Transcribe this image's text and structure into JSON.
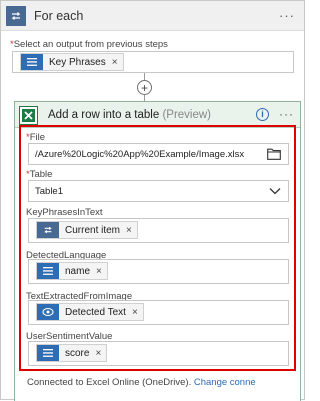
{
  "foreach": {
    "title": "For each",
    "more": "···",
    "select_label": "Select an output from previous steps",
    "required_mark": "*",
    "token": {
      "label": "Key Phrases",
      "close": "×",
      "icon": "list-icon"
    }
  },
  "add_step": {
    "label": "+"
  },
  "action": {
    "title": "Add a row into a table",
    "preview": "(Preview)",
    "info": "i",
    "more": "···",
    "icon": "excel-icon",
    "fields": {
      "file": {
        "label": "File",
        "required": "*",
        "value": "/Azure%20Logic%20App%20Example/Image.xlsx",
        "icon": "folder-icon"
      },
      "table": {
        "label": "Table",
        "required": "*",
        "value": "Table1",
        "icon": "chevron-down-icon"
      },
      "key_phrases": {
        "label": "KeyPhrasesInText",
        "token": {
          "label": "Current item",
          "close": "×",
          "icon": "loop-icon"
        }
      },
      "detected_language": {
        "label": "DetectedLanguage",
        "token": {
          "label": "name",
          "close": "×",
          "icon": "list-icon"
        }
      },
      "text_extracted": {
        "label": "TextExtractedFromImage",
        "token": {
          "label": "Detected Text",
          "close": "×",
          "icon": "eye-icon"
        }
      },
      "user_sentiment": {
        "label": "UserSentimentValue",
        "token": {
          "label": "score",
          "close": "×",
          "icon": "list-icon"
        }
      }
    },
    "connection_text": "Connected to Excel Online (OneDrive).",
    "change_link": "Change conne"
  },
  "colors": {
    "foreach_icon": "#486991",
    "token_blue": "#2e6db4",
    "excel_green": "#1d7b45",
    "highlight_red": "#e00000",
    "link_blue": "#2b6cb5"
  }
}
